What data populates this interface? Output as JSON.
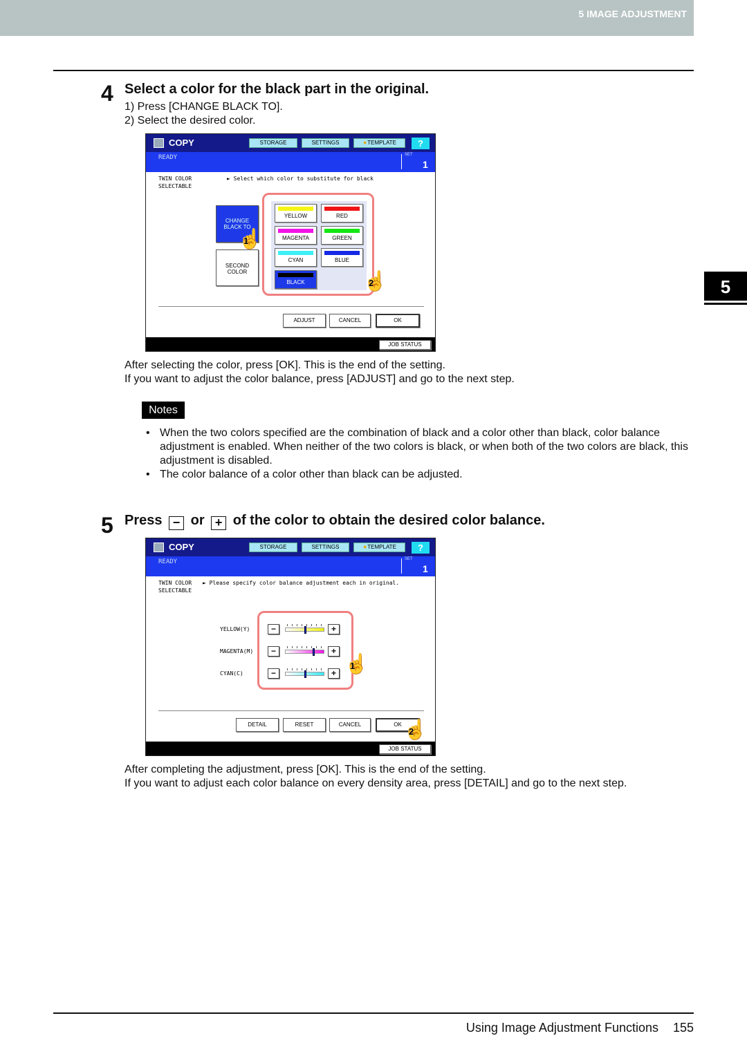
{
  "header": {
    "section": "5 IMAGE ADJUSTMENT",
    "tab_number": "5"
  },
  "step4": {
    "number": "4",
    "title": "Select a color for the black part in the original.",
    "substeps": [
      "1)  Press [CHANGE BLACK TO].",
      "2)  Select the desired color."
    ],
    "after": [
      "After selecting the color, press [OK]. This is the end of the setting.",
      "If you want to adjust the color balance, press [ADJUST] and go to the next step."
    ]
  },
  "screen1": {
    "title": "COPY",
    "tabs": [
      "STORAGE",
      "SETTINGS",
      "TEMPLATE"
    ],
    "help": "?",
    "status": "READY",
    "set_label": "SET",
    "set_value": "1",
    "mode": "TWIN COLOR\nSELECTABLE",
    "message": "► Select which color to substitute for black",
    "change_black_to": "CHANGE\nBLACK TO",
    "second_color": "SECOND\nCOLOR",
    "colors": [
      {
        "label": "YELLOW",
        "color": "#f5f514"
      },
      {
        "label": "RED",
        "color": "#f01414"
      },
      {
        "label": "MAGENTA",
        "color": "#f014e6"
      },
      {
        "label": "GREEN",
        "color": "#14e614"
      },
      {
        "label": "CYAN",
        "color": "#3cf0f5"
      },
      {
        "label": "BLUE",
        "color": "#1428e6"
      },
      {
        "label": "BLACK",
        "color": "#000000",
        "selected": true
      }
    ],
    "buttons": [
      "ADJUST",
      "CANCEL",
      "OK"
    ],
    "job_status": "JOB STATUS",
    "callouts": [
      "1",
      "2"
    ]
  },
  "notes": {
    "label": "Notes",
    "items": [
      "When the two colors specified are the combination of black and a color other than black, color balance adjustment is enabled. When neither of the two colors is black, or when both of the two colors are black, this adjustment is disabled.",
      "The color balance of a color other than black can be adjusted."
    ]
  },
  "step5": {
    "number": "5",
    "title_pre": "Press",
    "minus": "−",
    "or": "or",
    "plus": "+",
    "title_post": "of the color to obtain the desired color balance.",
    "after": [
      "After completing the adjustment, press [OK]. This is the end of the setting.",
      "If you want to adjust each color balance on every density area, press [DETAIL] and go to the next step."
    ]
  },
  "screen2": {
    "title": "COPY",
    "tabs": [
      "STORAGE",
      "SETTINGS",
      "TEMPLATE"
    ],
    "help": "?",
    "status": "READY",
    "set_label": "SET",
    "set_value": "1",
    "mode": "TWIN COLOR\nSELECTABLE",
    "message": "► Please specify color balance adjustment each in original.",
    "sliders": [
      {
        "label": "YELLOW(Y)",
        "color": "#f0f014",
        "level": 0.5
      },
      {
        "label": "MAGENTA(M)",
        "color": "#f014e6",
        "level": 0.72
      },
      {
        "label": "CYAN(C)",
        "color": "#3ce6f0",
        "level": 0.5
      }
    ],
    "buttons": [
      "DETAIL",
      "RESET",
      "CANCEL",
      "OK"
    ],
    "job_status": "JOB STATUS",
    "callouts": [
      "1",
      "2"
    ]
  },
  "footer": {
    "title": "Using Image Adjustment Functions",
    "page": "155"
  }
}
